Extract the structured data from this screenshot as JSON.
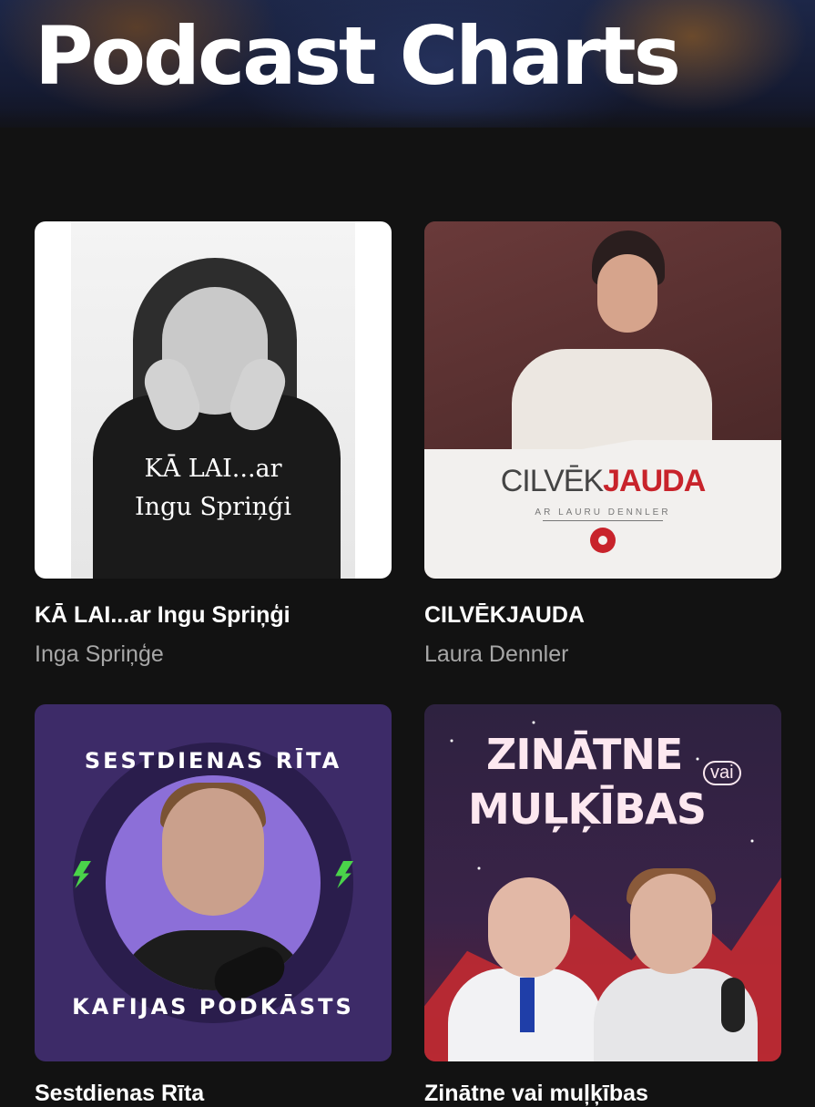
{
  "header": {
    "title": "Podcast Charts"
  },
  "podcasts": [
    {
      "title": "KĀ LAI...ar Ingu Spriņģi",
      "author": "Inga Spriņģe",
      "cover_text_1": "KĀ LAI...ar",
      "cover_text_2": "Ingu Spriņģi"
    },
    {
      "title": "CILVĒKJAUDA",
      "author": "Laura Dennler",
      "cover_brand_a": "CILVĒK",
      "cover_brand_b": "JAUDA",
      "cover_sub": "AR LAURU DENNLER"
    },
    {
      "title": "Sestdienas Rīta",
      "author": "",
      "cover_text_top": "SESTDIENAS RĪTA",
      "cover_text_bottom": "KAFIJAS PODKĀSTS"
    },
    {
      "title": "Zinātne vai muļķības",
      "author": "",
      "cover_text_1": "ZINĀTNE",
      "cover_text_vai": "vai",
      "cover_text_2": "MUĻĶĪBAS"
    }
  ],
  "colors": {
    "background": "#121212",
    "subtext": "#a7a7a7",
    "accent_red": "#c8232b",
    "accent_green": "#4ad34a"
  }
}
